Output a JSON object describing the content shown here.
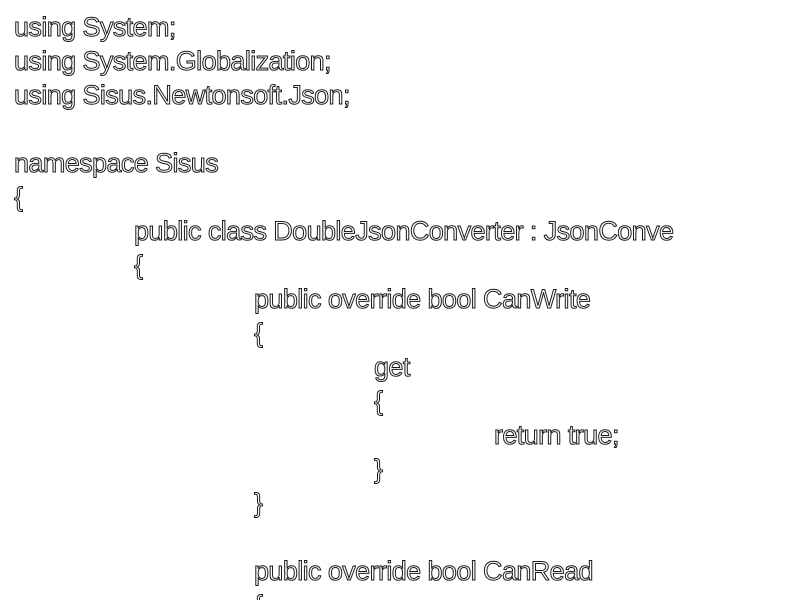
{
  "code": {
    "lines": [
      "using System;",
      "using System.Globalization;",
      "using Sisus.Newtonsoft.Json;",
      "",
      "namespace Sisus",
      "{",
      "public class DoubleJsonConverter : JsonConve",
      "{",
      "public override bool CanWrite",
      "{",
      "get",
      "{",
      "return true;",
      "}",
      "}",
      "",
      "public override bool CanRead",
      "{"
    ]
  },
  "colors": {
    "background": "#ffffff",
    "text_fill": "#ffffff",
    "text_outline": "#1a1a1a"
  }
}
